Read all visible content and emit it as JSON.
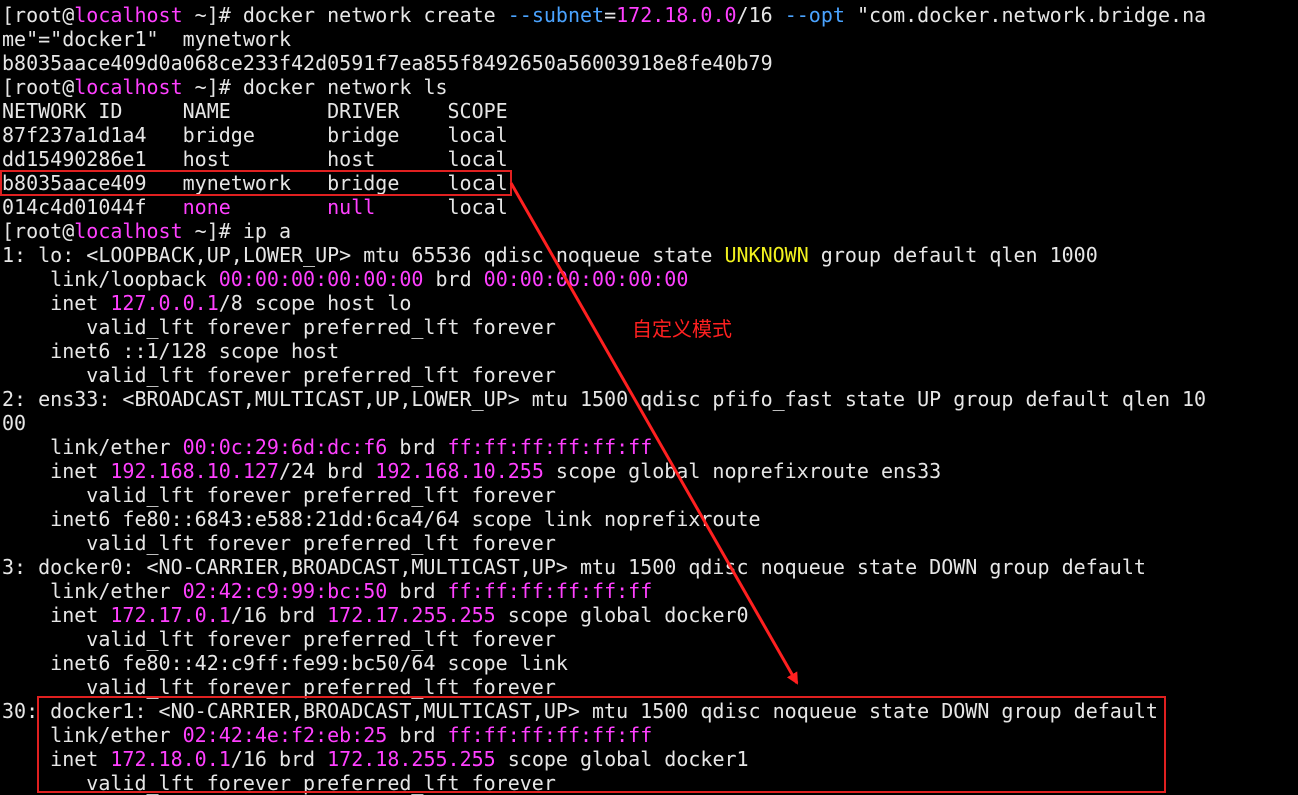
{
  "terminal": {
    "colors": {
      "background": "#000000",
      "text": "#e6e6e6",
      "magenta": "#ff40ff",
      "yellow": "#f2f21e",
      "blue": "#4aa3ff",
      "annotation": "#ff2020"
    },
    "lines": [
      [
        {
          "c": "w",
          "t": "[root@"
        },
        {
          "c": "m",
          "t": "localhost"
        },
        {
          "c": "w",
          "t": " ~]# docker network create "
        },
        {
          "c": "b",
          "t": "--subnet"
        },
        {
          "c": "w",
          "t": "="
        },
        {
          "c": "m",
          "t": "172.18.0.0"
        },
        {
          "c": "w",
          "t": "/16 "
        },
        {
          "c": "b",
          "t": "--opt"
        },
        {
          "c": "w",
          "t": " \"com.docker.network.bridge.na"
        }
      ],
      [
        {
          "c": "w",
          "t": "me\"=\"docker1\"  mynetwork"
        }
      ],
      [
        {
          "c": "w",
          "t": "b8035aace409d0a068ce233f42d0591f7ea855f8492650a56003918e8fe40b79"
        }
      ],
      [
        {
          "c": "w",
          "t": "[root@"
        },
        {
          "c": "m",
          "t": "localhost"
        },
        {
          "c": "w",
          "t": " ~]# docker network ls"
        }
      ],
      [
        {
          "c": "w",
          "t": "NETWORK ID     NAME        DRIVER    SCOPE"
        }
      ],
      [
        {
          "c": "w",
          "t": "87f237a1d1a4   bridge      bridge    local"
        }
      ],
      [
        {
          "c": "w",
          "t": "dd15490286e1   host        host      local"
        }
      ],
      [
        {
          "c": "w",
          "t": "b8035aace409   mynetwork   bridge    local"
        }
      ],
      [
        {
          "c": "w",
          "t": "014c4d01044f   "
        },
        {
          "c": "m",
          "t": "none"
        },
        {
          "c": "w",
          "t": "        "
        },
        {
          "c": "m",
          "t": "null"
        },
        {
          "c": "w",
          "t": "      local"
        }
      ],
      [
        {
          "c": "w",
          "t": "[root@"
        },
        {
          "c": "m",
          "t": "localhost"
        },
        {
          "c": "w",
          "t": " ~]# ip a"
        }
      ],
      [
        {
          "c": "w",
          "t": "1: lo: <LOOPBACK,UP,LOWER_UP> mtu 65536 qdisc noqueue state "
        },
        {
          "c": "y",
          "t": "UNKNOWN"
        },
        {
          "c": "w",
          "t": " group default qlen 1000"
        }
      ],
      [
        {
          "c": "w",
          "t": "    link/loopback "
        },
        {
          "c": "m",
          "t": "00:00:00:00:00:00"
        },
        {
          "c": "w",
          "t": " brd "
        },
        {
          "c": "m",
          "t": "00:00:00:00:00:00"
        }
      ],
      [
        {
          "c": "w",
          "t": "    inet "
        },
        {
          "c": "m",
          "t": "127.0.0.1"
        },
        {
          "c": "w",
          "t": "/8 scope host lo"
        }
      ],
      [
        {
          "c": "w",
          "t": "       valid_lft forever preferred_lft forever"
        }
      ],
      [
        {
          "c": "w",
          "t": "    inet6 ::1/128 scope host"
        }
      ],
      [
        {
          "c": "w",
          "t": "       valid_lft forever preferred_lft forever"
        }
      ],
      [
        {
          "c": "w",
          "t": "2: ens33: <BROADCAST,MULTICAST,UP,LOWER_UP> mtu 1500 qdisc pfifo_fast state UP group default qlen 10"
        }
      ],
      [
        {
          "c": "w",
          "t": "00"
        }
      ],
      [
        {
          "c": "w",
          "t": "    link/ether "
        },
        {
          "c": "m",
          "t": "00:0c:29:6d:dc:f6"
        },
        {
          "c": "w",
          "t": " brd "
        },
        {
          "c": "m",
          "t": "ff:ff:ff:ff:ff:ff"
        }
      ],
      [
        {
          "c": "w",
          "t": "    inet "
        },
        {
          "c": "m",
          "t": "192.168.10.127"
        },
        {
          "c": "w",
          "t": "/24 brd "
        },
        {
          "c": "m",
          "t": "192.168.10.255"
        },
        {
          "c": "w",
          "t": " scope global noprefixroute ens33"
        }
      ],
      [
        {
          "c": "w",
          "t": "       valid_lft forever preferred_lft forever"
        }
      ],
      [
        {
          "c": "w",
          "t": "    inet6 fe80::6843:e588:21dd:6ca4/64 scope link noprefixroute"
        }
      ],
      [
        {
          "c": "w",
          "t": "       valid_lft forever preferred_lft forever"
        }
      ],
      [
        {
          "c": "w",
          "t": "3: docker0: <NO-CARRIER,BROADCAST,MULTICAST,UP> mtu 1500 qdisc noqueue state DOWN group default"
        }
      ],
      [
        {
          "c": "w",
          "t": "    link/ether "
        },
        {
          "c": "m",
          "t": "02:42:c9:99:bc:50"
        },
        {
          "c": "w",
          "t": " brd "
        },
        {
          "c": "m",
          "t": "ff:ff:ff:ff:ff:ff"
        }
      ],
      [
        {
          "c": "w",
          "t": "    inet "
        },
        {
          "c": "m",
          "t": "172.17.0.1"
        },
        {
          "c": "w",
          "t": "/16 brd "
        },
        {
          "c": "m",
          "t": "172.17.255.255"
        },
        {
          "c": "w",
          "t": " scope global docker0"
        }
      ],
      [
        {
          "c": "w",
          "t": "       valid_lft forever preferred_lft forever"
        }
      ],
      [
        {
          "c": "w",
          "t": "    inet6 fe80::42:c9ff:fe99:bc50/64 scope link"
        }
      ],
      [
        {
          "c": "w",
          "t": "       valid_lft forever preferred_lft forever"
        }
      ],
      [
        {
          "c": "w",
          "t": "30: docker1: <NO-CARRIER,BROADCAST,MULTICAST,UP> mtu 1500 qdisc noqueue state DOWN group default"
        }
      ],
      [
        {
          "c": "w",
          "t": "    link/ether "
        },
        {
          "c": "m",
          "t": "02:42:4e:f2:eb:25"
        },
        {
          "c": "w",
          "t": " brd "
        },
        {
          "c": "m",
          "t": "ff:ff:ff:ff:ff:ff"
        }
      ],
      [
        {
          "c": "w",
          "t": "    inet "
        },
        {
          "c": "m",
          "t": "172.18.0.1"
        },
        {
          "c": "w",
          "t": "/16 brd "
        },
        {
          "c": "m",
          "t": "172.18.255.255"
        },
        {
          "c": "w",
          "t": " scope global docker1"
        }
      ],
      [
        {
          "c": "w",
          "t": "       valid_lft forever preferred_lft forever"
        }
      ]
    ]
  },
  "annotation": {
    "label": "自定义模式"
  }
}
